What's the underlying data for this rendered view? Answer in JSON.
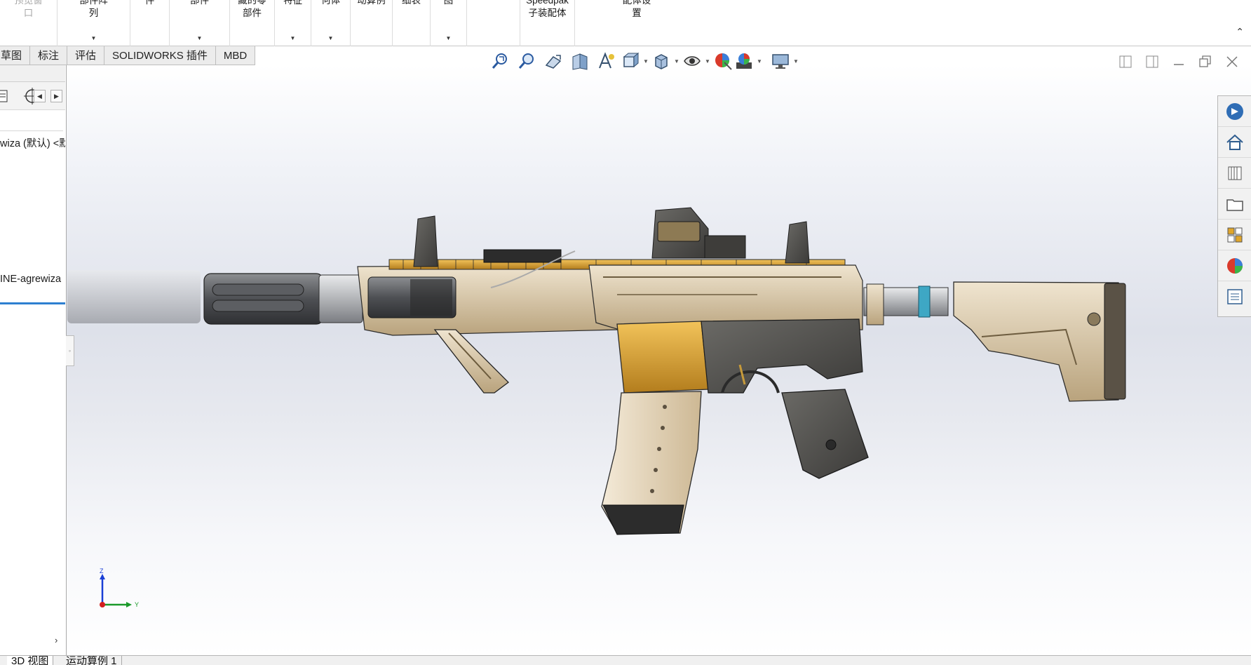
{
  "ribbon": {
    "items": [
      {
        "label": "预览窗\n口",
        "disabled": true
      },
      {
        "label": "部件阵\n列",
        "dropdown": true
      },
      {
        "label": "件"
      },
      {
        "label": "部件",
        "dropdown": true
      },
      {
        "label": "藏的零\n部件"
      },
      {
        "label": "特征",
        "dropdown": true
      },
      {
        "label": "何体",
        "dropdown": true
      },
      {
        "label": "动算例"
      },
      {
        "label": "细表"
      },
      {
        "label": "图",
        "dropdown": true
      },
      {
        "label": ""
      },
      {
        "label": "Speedpak\n子装配体"
      },
      {
        "label": "配体设\n置"
      }
    ],
    "collapse_glyph": "⌃"
  },
  "command_tabs": [
    "草图",
    "标注",
    "评估",
    "SOLIDWORKS 插件",
    "MBD"
  ],
  "feature_tree": {
    "root_label": "wiza (默认) <默",
    "selected_item": "INE-agrewiza",
    "expand_glyph": "›"
  },
  "hud_toolbar": {
    "icons": [
      "zoom-to-fit-icon",
      "zoom-to-area-icon",
      "previous-view-icon",
      "section-view-icon",
      "dynamic-annotation-views-icon",
      "view-orientation-icon",
      "display-style-icon",
      "hide-show-items-icon",
      "edit-appearance-icon",
      "apply-scene-icon",
      "view-settings-icon"
    ]
  },
  "task_pane": {
    "icons": [
      "solidworks-resources-icon",
      "home-icon",
      "design-library-icon",
      "file-explorer-icon",
      "view-palette-icon",
      "appearances-scenes-icon",
      "custom-properties-icon"
    ]
  },
  "triad": {
    "z": "Z",
    "y": "Y"
  },
  "bottom_tabs": [
    "3D 视图",
    "运动算例 1"
  ],
  "colors": {
    "accent_blue": "#2e7fd0",
    "rifle_tan": "#d9c7a6",
    "rifle_gold": "#d9a030",
    "rifle_dark": "#4a4a48",
    "suppressor_gray": "#7b7d82"
  }
}
